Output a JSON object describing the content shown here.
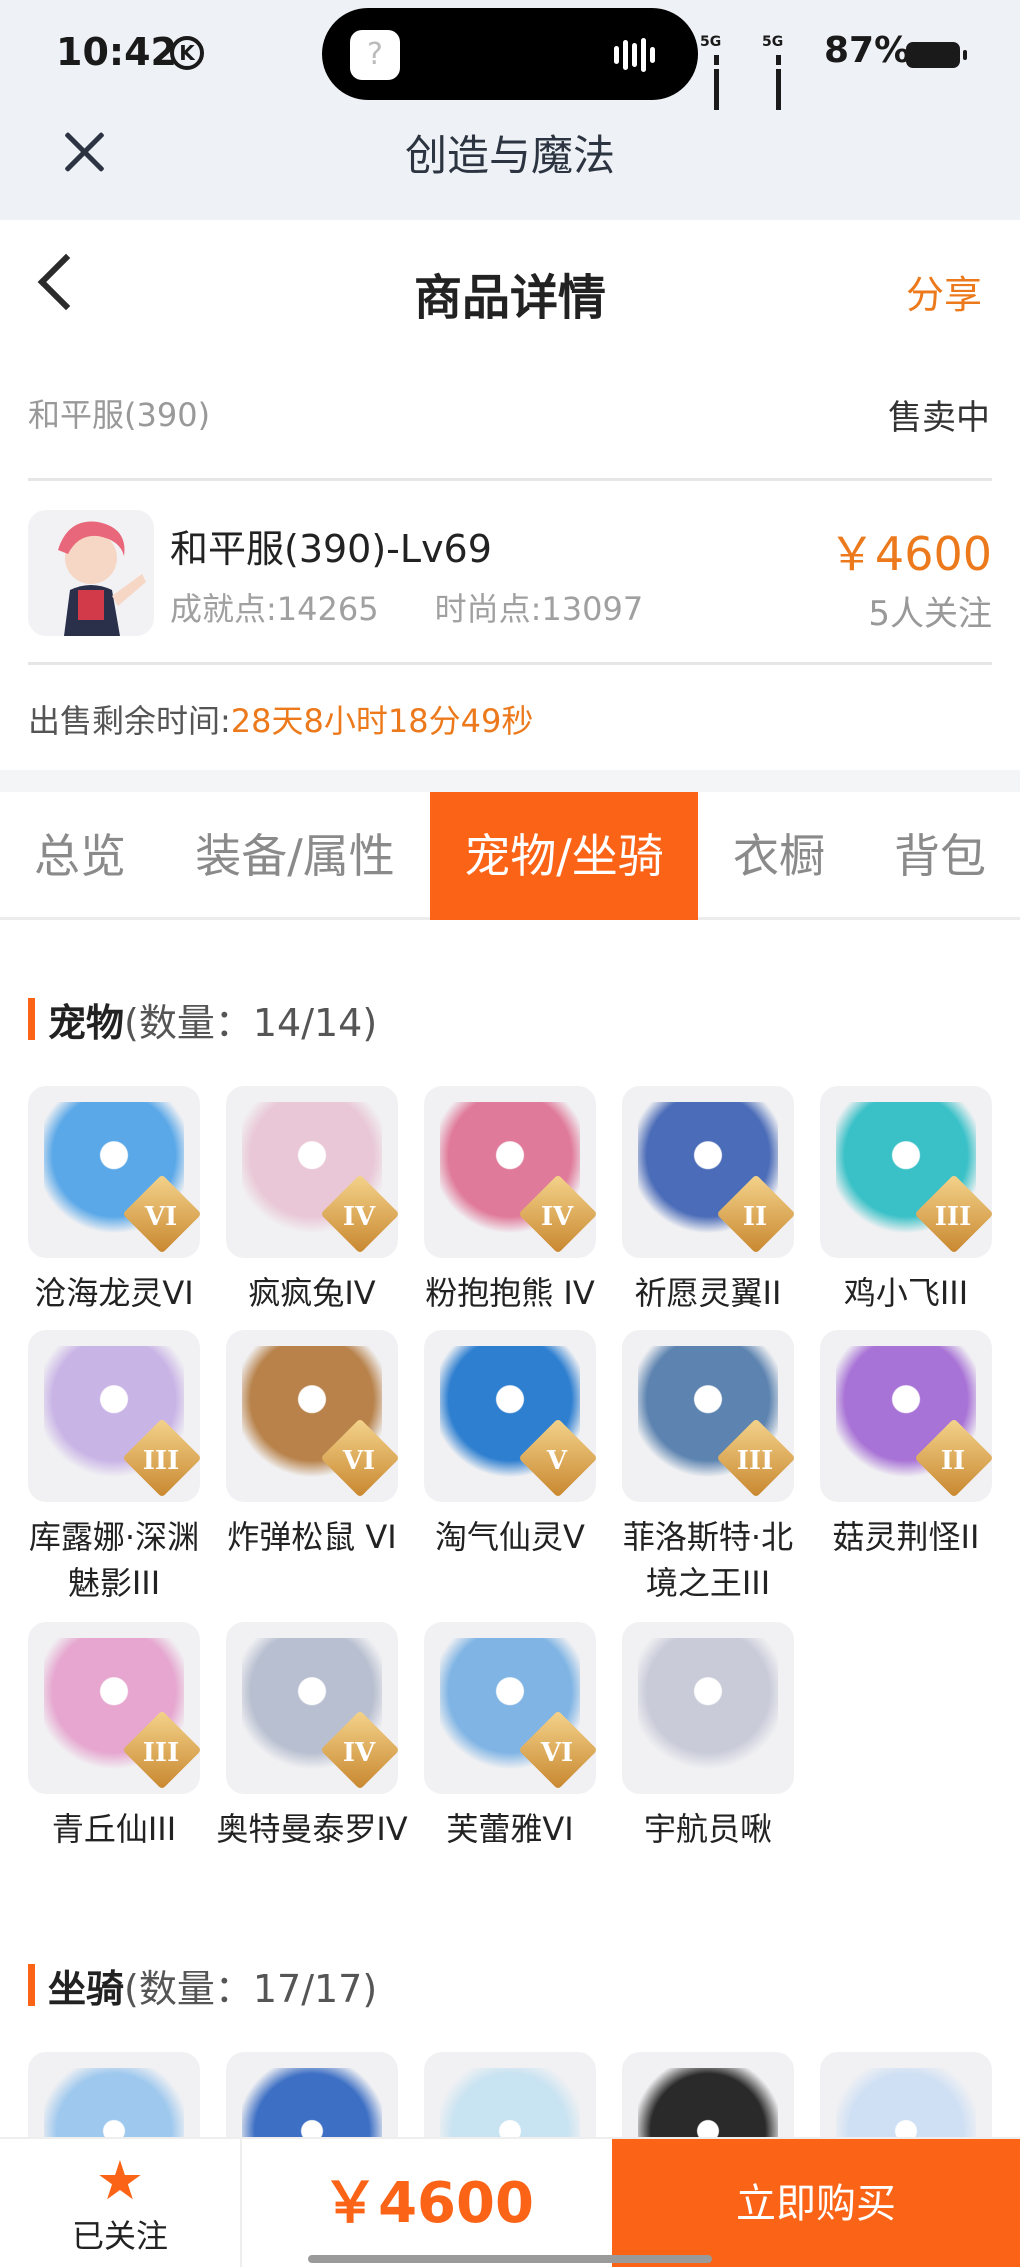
{
  "status_bar": {
    "time": "10:42",
    "k_icon": "K",
    "battery": "87%",
    "net1": "5G",
    "net2": "5G"
  },
  "app_bar": {
    "title": "创造与魔法"
  },
  "nav": {
    "title": "商品详情",
    "share": "分享"
  },
  "listing": {
    "server": "和平服(390)",
    "status": "售卖中",
    "name": "和平服(390)-Lv69",
    "achievement": "成就点:14265",
    "fashion": "时尚点:13097",
    "price": "￥4600",
    "followers": "5人关注",
    "remain_label": "出售剩余时间:",
    "remain_time": "28天8小时18分49秒"
  },
  "tabs": [
    "总览",
    "装备/属性",
    "宠物/坐骑",
    "衣橱",
    "背包"
  ],
  "active_tab": "宠物/坐骑",
  "pets_section": {
    "title": "宠物",
    "count": "(数量：14/14)"
  },
  "pets": [
    {
      "name": "沧海龙灵VI",
      "badge": "VI",
      "color": "#5aa8e8"
    },
    {
      "name": "疯疯兔IV",
      "badge": "IV",
      "color": "#e9c7d6"
    },
    {
      "name": "粉抱抱熊 IV",
      "badge": "IV",
      "color": "#e07a9a"
    },
    {
      "name": "祈愿灵翼II",
      "badge": "II",
      "color": "#4b6cb8"
    },
    {
      "name": "鸡小飞III",
      "badge": "III",
      "color": "#3ac1c7"
    },
    {
      "name": "库露娜·深渊魅影III",
      "badge": "III",
      "color": "#c9b4e6"
    },
    {
      "name": "炸弹松鼠 VI",
      "badge": "VI",
      "color": "#b8824a"
    },
    {
      "name": "淘气仙灵V",
      "badge": "V",
      "color": "#2e7fd0"
    },
    {
      "name": "菲洛斯特·北境之王III",
      "badge": "III",
      "color": "#5d84b0"
    },
    {
      "name": "菇灵荆怪II",
      "badge": "II",
      "color": "#a873d6"
    },
    {
      "name": "青丘仙III",
      "badge": "III",
      "color": "#e6a6cf"
    },
    {
      "name": "奥特曼泰罗IV",
      "badge": "IV",
      "color": "#b8bfd0"
    },
    {
      "name": "芙蕾雅VI",
      "badge": "VI",
      "color": "#7fb4e4"
    },
    {
      "name": "宇航员啾",
      "badge": "",
      "color": "#c9cbd9"
    }
  ],
  "mounts_section": {
    "title": "坐骑",
    "count": "(数量：17/17)"
  },
  "mounts_preview": [
    "#9ec8ee",
    "#3d6fc4",
    "#c8e3f2",
    "#2a2a2a",
    "#cfe0f4"
  ],
  "bottom": {
    "followed": "已关注",
    "price": "￥4600",
    "buy": "立即购买"
  },
  "colors": {
    "accent": "#fb6417",
    "price": "#ec7a1c"
  }
}
